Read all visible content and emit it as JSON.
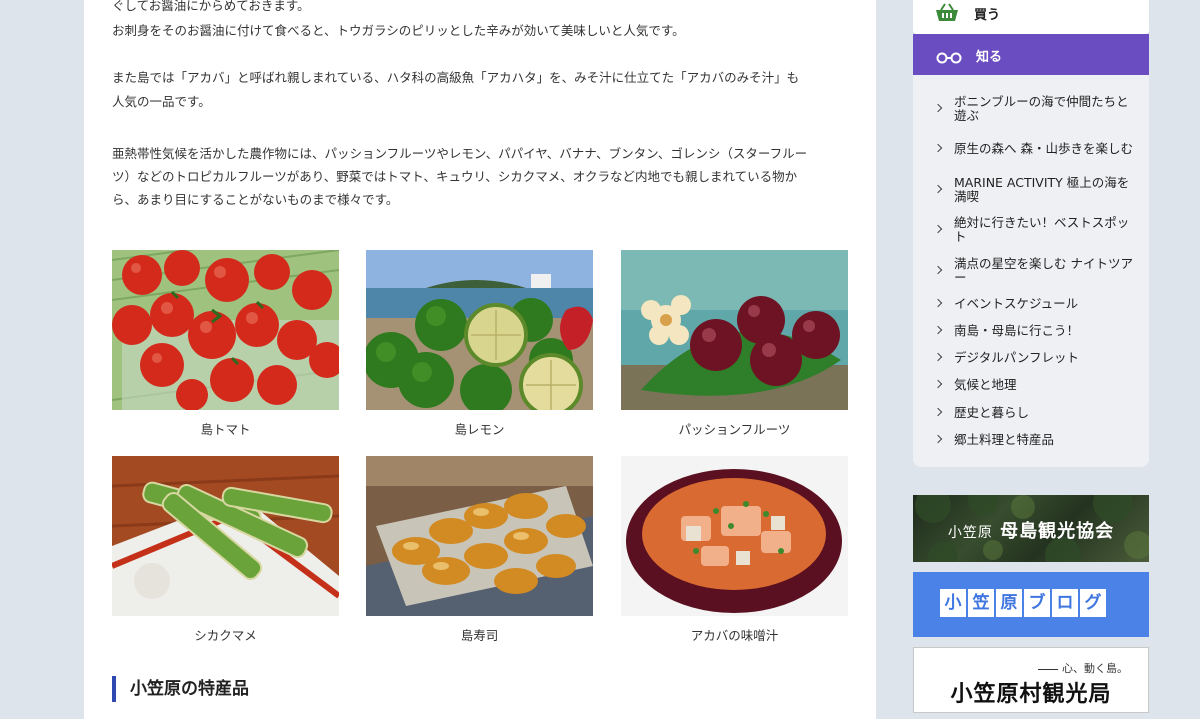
{
  "paragraphs": [
    "ぐしてお醤油にからめておきます。",
    "お刺身をそのお醤油に付けて食べると、トウガラシのピリッとした辛みが効いて美味しいと人気です。",
    "また島では「アカバ」と呼ばれ親しまれている、ハタ科の高級魚「アカハタ」を、みそ汁に仕立てた「アカバのみそ汁」も",
    "人気の一品です。",
    "亜熱帯性気候を活かした農作物には、パッションフルーツやレモン、パパイヤ、バナナ、ブンタン、ゴレンシ（スターフルー",
    "ツ）などのトロピカルフルーツがあり、野菜ではトマト、キュウリ、シカクマメ、オクラなど内地でも親しまれている物か",
    "ら、あまり目にすることがないものまで様々です。"
  ],
  "photos": [
    {
      "caption": "島トマト",
      "icon": "tomato-photo"
    },
    {
      "caption": "島レモン",
      "icon": "lemon-photo"
    },
    {
      "caption": "パッションフルーツ",
      "icon": "passionfruit-photo"
    },
    {
      "caption": "シカクマメ",
      "icon": "wingedbean-photo"
    },
    {
      "caption": "島寿司",
      "icon": "sushi-photo"
    },
    {
      "caption": "アカバの味噌汁",
      "icon": "misosoup-photo"
    }
  ],
  "section_heading": "小笠原の特産品",
  "sidebar": {
    "buy_label": "買う",
    "know_label": "知る",
    "menu": [
      "ボニンブルーの海で仲間たちと遊ぶ",
      "原生の森へ 森・山歩きを楽しむ",
      "MARINE ACTIVITY 極上の海を満喫",
      "絶対に行きたい！ベストスポット",
      "満点の星空を楽しむ ナイトツアー",
      "イベントスケジュール",
      "南島・母島に行こう！",
      "デジタルパンフレット",
      "気候と地理",
      "歴史と暮らし",
      "郷土料理と特産品"
    ],
    "banners": {
      "hahajima_small": "小笠原",
      "hahajima_main": "母島観光協会",
      "blog_chars": [
        "小",
        "笠",
        "原",
        "ブ",
        "ロ",
        "グ"
      ],
      "village_tagline": "心、動く島。",
      "village_title": "小笠原村観光局"
    }
  },
  "colors": {
    "know_bar": "#6a4dc0",
    "heading_accent": "#2f49b3",
    "blog_banner": "#4a82e8",
    "basket_icon": "#3c8a3a"
  }
}
